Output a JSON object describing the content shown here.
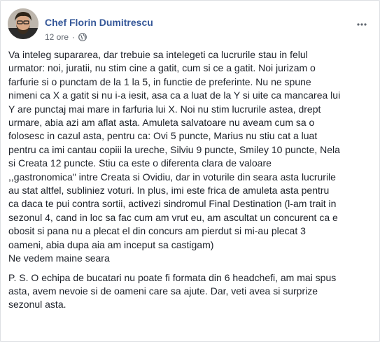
{
  "post": {
    "author": "Chef Florin Dumitrescu",
    "time": "12 ore",
    "separator": "·",
    "audience_icon": "globe-icon",
    "more_icon": "more-options-icon",
    "paragraph1": [
      "Va inteleg supararea, dar trebuie sa intelegeti ca lucrurile stau in felul",
      "urmator: noi, juratii, nu stim cine a gatit, cum si ce a gatit. Noi jurizam o",
      "farfurie si o punctam de la 1 la 5, in functie de preferinte. Nu ne spune",
      "nimeni ca X a gatit si nu i-a iesit, asa ca a luat de la Y si uite ca mancarea lui",
      "Y are punctaj mai mare in farfuria lui X. Noi nu stim lucrurile astea, drept",
      "urmare, abia azi am aflat asta. Amuleta salvatoare nu aveam cum sa o",
      "folosesc in cazul asta, pentru ca: Ovi 5 puncte, Marius nu stiu cat a luat",
      "pentru ca imi cantau copiii la ureche, Silviu 9 puncte, Smiley 10 puncte, Nela",
      "si Creata 12 puncte. Stiu ca este o diferenta clara de valoare",
      ",,gastronomica\" intre Creata si Ovidiu, dar in voturile din seara asta lucrurile",
      "au stat altfel, subliniez voturi. In plus, imi este frica de amuleta asta pentru",
      "ca daca te pui contra sortii, activezi sindromul Final Destination (l-am trait in",
      "sezonul 4, cand in loc sa fac cum am vrut eu, am ascultat un concurent ca e",
      "obosit si pana nu a plecat el din concurs am pierdut si mi-au plecat 3",
      "oameni, abia dupa aia am inceput sa castigam)",
      "Ne vedem maine seara"
    ],
    "paragraph2": [
      "P. S. O echipa de bucatari nu poate fi formata din 6 headchefi, am mai spus",
      "asta, avem nevoie si de oameni care sa ajute. Dar, veti avea si surprize",
      "sezonul asta."
    ]
  }
}
